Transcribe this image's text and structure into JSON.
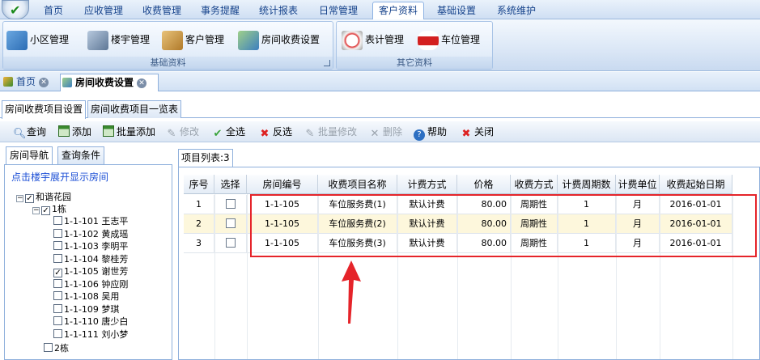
{
  "menubar": {
    "items": [
      "首页",
      "应收管理",
      "收费管理",
      "事务提醒",
      "统计报表",
      "日常管理",
      "客户资料",
      "基础设置",
      "系统维护"
    ],
    "active_index": 6
  },
  "ribbon": {
    "groups": [
      {
        "label": "基础资料",
        "buttons": [
          "小区管理",
          "楼宇管理",
          "客户管理",
          "房间收费设置"
        ]
      },
      {
        "label": "其它资料",
        "buttons": [
          "表计管理",
          "车位管理"
        ]
      }
    ]
  },
  "doc_tabs": [
    "首页",
    "房间收费设置"
  ],
  "sub_tabs": [
    "房间收费项目设置",
    "房间收费项目一览表"
  ],
  "toolbar": {
    "query": "查询",
    "add": "添加",
    "batch_add": "批量添加",
    "edit": "修改",
    "select_all": "全选",
    "invert": "反选",
    "batch_edit": "批量修改",
    "delete": "删除",
    "help": "帮助",
    "close": "关闭"
  },
  "left": {
    "tabs": [
      "房间导航",
      "查询条件"
    ],
    "hint": "点击楼宇展开显示房间",
    "root": "和谐花园",
    "building1": "1栋",
    "building2": "2栋",
    "rooms": [
      {
        "label": "1-1-101 王志平",
        "checked": false
      },
      {
        "label": "1-1-102 黄成瑶",
        "checked": false
      },
      {
        "label": "1-1-103 李明平",
        "checked": false
      },
      {
        "label": "1-1-104 黎桂芳",
        "checked": false
      },
      {
        "label": "1-1-105 谢世芳",
        "checked": true
      },
      {
        "label": "1-1-106 钟应刚",
        "checked": false
      },
      {
        "label": "1-1-108 吴用",
        "checked": false
      },
      {
        "label": "1-1-109 梦琪",
        "checked": false
      },
      {
        "label": "1-1-110 唐少白",
        "checked": false
      },
      {
        "label": "1-1-111 刘小梦",
        "checked": false
      }
    ]
  },
  "grid": {
    "tab_label": "项目列表:3",
    "columns": [
      "序号",
      "选择",
      "房间编号",
      "收费项目名称",
      "计费方式",
      "价格",
      "收费方式",
      "计费周期数",
      "计费单位",
      "收费起始日期"
    ],
    "rows": [
      [
        "1",
        "",
        "1-1-105",
        "车位服务费(1)",
        "默认计费",
        "80.00",
        "周期性",
        "1",
        "月",
        "2016-01-01"
      ],
      [
        "2",
        "",
        "1-1-105",
        "车位服务费(2)",
        "默认计费",
        "80.00",
        "周期性",
        "1",
        "月",
        "2016-01-01"
      ],
      [
        "3",
        "",
        "1-1-105",
        "车位服务费(3)",
        "默认计费",
        "80.00",
        "周期性",
        "1",
        "月",
        "2016-01-01"
      ]
    ]
  },
  "colors": {
    "highlight_box": "#e5242a",
    "alt_row": "#fdf7dc",
    "accent": "#15428b"
  }
}
